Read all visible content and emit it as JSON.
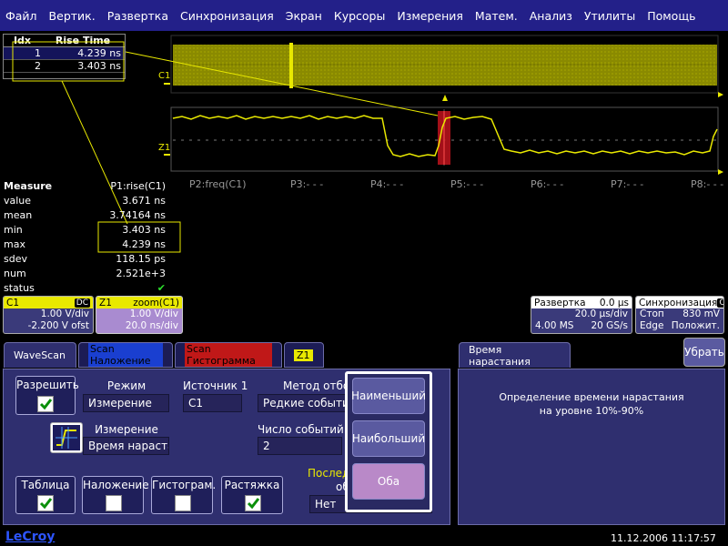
{
  "menu": [
    "Файл",
    "Вертик.",
    "Развертка",
    "Синхронизация",
    "Экран",
    "Курсоры",
    "Измерения",
    "Матем.",
    "Анализ",
    "Утилиты",
    "Помощь"
  ],
  "idx_table": {
    "headers": [
      "Idx",
      "Rise Time"
    ],
    "rows": [
      [
        "1",
        "4.239 ns"
      ],
      [
        "2",
        "3.403 ns"
      ]
    ]
  },
  "traces": {
    "c1_label": "C1",
    "z1_label": "Z1"
  },
  "params": [
    "P2:freq(C1)",
    "P3:- - -",
    "P4:- - -",
    "P5:- - -",
    "P6:- - -",
    "P7:- - -",
    "P8:- - -"
  ],
  "measure": {
    "title": "Measure",
    "param_name": "P1:rise(C1)",
    "rows": [
      [
        "value",
        "3.671 ns"
      ],
      [
        "mean",
        "3.74164 ns"
      ],
      [
        "min",
        "3.403 ns"
      ],
      [
        "max",
        "4.239 ns"
      ],
      [
        "sdev",
        "118.15 ps"
      ],
      [
        "num",
        "2.521e+3"
      ],
      [
        "status",
        "✔"
      ]
    ]
  },
  "channels": {
    "c1": {
      "name": "C1",
      "coupling": "DC",
      "line1": "1.00 V/div",
      "line2": "-2.200 V ofst",
      "color": "#e9e900"
    },
    "z1": {
      "name": "Z1",
      "title": "zoom(C1)",
      "line1": "1.00 V/div",
      "line2": "20.0 ns/div",
      "color": "#e9e900",
      "bg": "#a98bd0"
    }
  },
  "timebase": {
    "title": "Развертка",
    "delay": "0.0 µs",
    "line1_right": "20.0 µs/div",
    "line2_left": "4.00 MS",
    "line2_right": "20 GS/s"
  },
  "trigger": {
    "title": "Синхронизация",
    "ch": "C1",
    "line1_left": "Стоп",
    "line1_right": "830 mV",
    "line2_left": "Edge",
    "line2_right": "Положит."
  },
  "tabs": [
    "WaveScan",
    "Scan Наложение",
    "Scan Гистограмма",
    "Z1"
  ],
  "left_panel": {
    "enable_label": "Разрешить",
    "mode_label": "Режим",
    "mode_value": "Измерение",
    "source_label": "Источник 1",
    "source_value": "C1",
    "method_label": "Метод отбор",
    "method_value": "Редкие события",
    "measurement_label": "Измерение",
    "measurement_value": "Время нараста",
    "events_label": "Число событий",
    "events_value": "2",
    "last_label": "Послед",
    "last_sub": "об",
    "last_value": "Нет",
    "toggles": [
      {
        "label": "Таблица",
        "checked": true
      },
      {
        "label": "Наложение",
        "checked": false
      },
      {
        "label": "Гистограм.",
        "checked": false
      },
      {
        "label": "Растяжка",
        "checked": true
      }
    ]
  },
  "popup": [
    "Наименьший",
    "Наибольший",
    "Оба"
  ],
  "right_panel": {
    "title": "Время нарастания",
    "close": "Убрать",
    "desc1": "Определение времени нарастания",
    "desc2": "на уровне 10%-90%"
  },
  "footer": {
    "brand": "LeCroy",
    "datetime": "11.12.2006 11:17:57"
  },
  "colors": {
    "menubar": "#232089",
    "trace": "#e9e900",
    "panel": "#2f2f6f",
    "highlight": "#b5121b",
    "popup_selected": "#b989c8"
  }
}
